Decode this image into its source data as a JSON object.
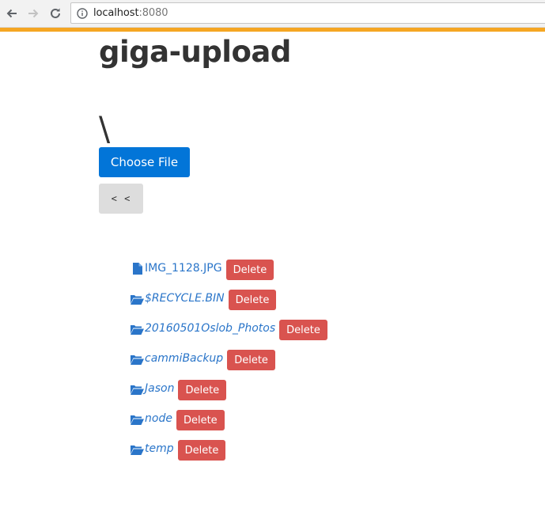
{
  "browser": {
    "url_host": "localhost",
    "url_port": ":8080"
  },
  "page": {
    "title": "giga-upload",
    "current_path": "\\",
    "choose_file_label": "Choose File",
    "back_label": "< <",
    "delete_label": "Delete"
  },
  "files": [
    {
      "name": "IMG_1128.JPG",
      "type": "file"
    },
    {
      "name": "$RECYCLE.BIN",
      "type": "folder"
    },
    {
      "name": "20160501Oslob_Photos",
      "type": "folder"
    },
    {
      "name": "cammiBackup",
      "type": "folder"
    },
    {
      "name": "Jason",
      "type": "folder"
    },
    {
      "name": "node",
      "type": "folder"
    },
    {
      "name": "temp",
      "type": "folder"
    }
  ],
  "colors": {
    "accent": "#f5a623",
    "primary": "#0275d8",
    "danger": "#d9534f",
    "link": "#2a75c9"
  }
}
